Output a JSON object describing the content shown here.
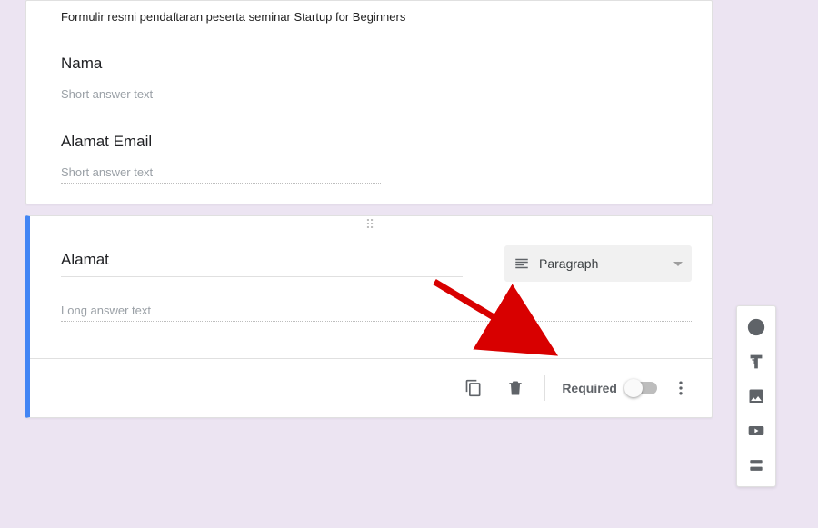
{
  "form": {
    "description": "Formulir resmi pendaftaran peserta seminar Startup for Beginners",
    "questions": [
      {
        "title": "Nama",
        "placeholder": "Short answer text"
      },
      {
        "title": "Alamat Email",
        "placeholder": "Short answer text"
      }
    ],
    "editing": {
      "title": "Alamat",
      "long_placeholder": "Long answer text",
      "type_label": "Paragraph",
      "required_label": "Required"
    }
  }
}
